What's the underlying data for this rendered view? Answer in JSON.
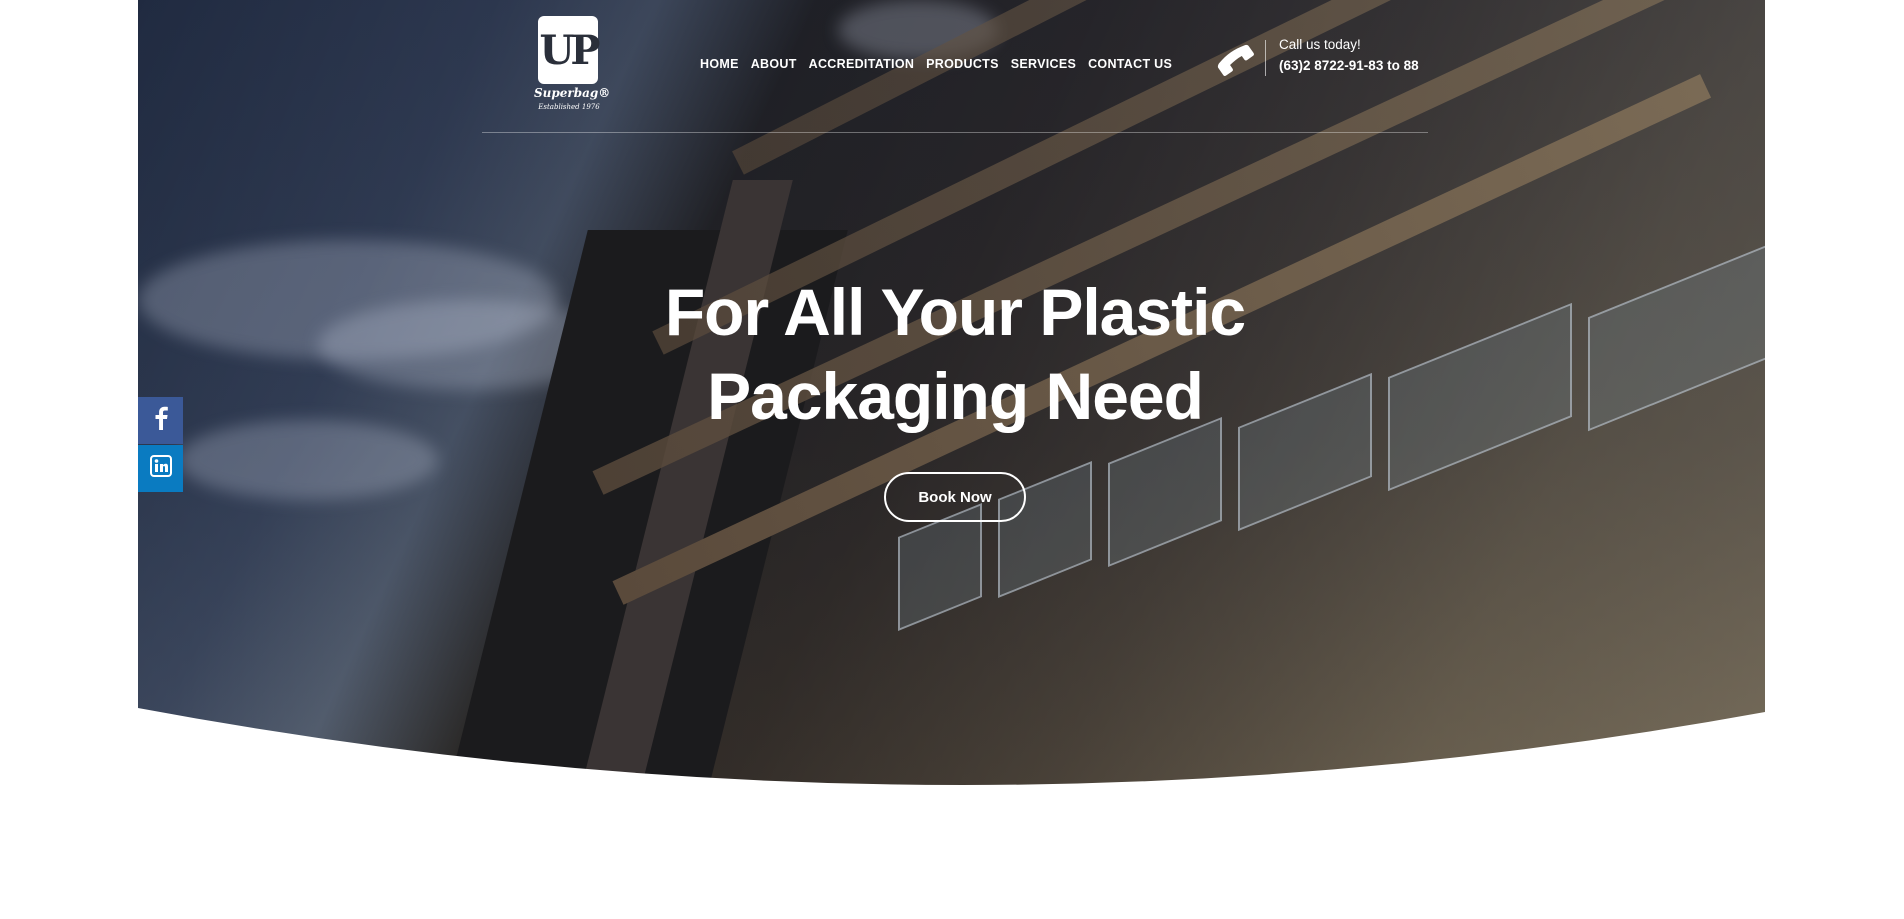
{
  "brand": {
    "logo_letters": "UP",
    "wordmark": "Superbag®",
    "established": "Established 1976"
  },
  "nav": {
    "items": [
      {
        "label": "HOME"
      },
      {
        "label": "ABOUT"
      },
      {
        "label": "ACCREDITATION"
      },
      {
        "label": "PRODUCTS"
      },
      {
        "label": "SERVICES"
      },
      {
        "label": "CONTACT US"
      }
    ]
  },
  "contact": {
    "label": "Call us today!",
    "number": "(63)2 8722-91-83 to 88",
    "icon": "phone-icon"
  },
  "hero": {
    "headline_line1": "For All Your Plastic",
    "headline_line2": "Packaging Need",
    "button_label": "Book Now"
  },
  "social": {
    "items": [
      {
        "icon": "facebook-icon",
        "color": "#3b5998"
      },
      {
        "icon": "linkedin-icon",
        "color": "#0a7bc1"
      }
    ]
  },
  "colors": {
    "text": "#ffffff",
    "background": "#ffffff"
  }
}
